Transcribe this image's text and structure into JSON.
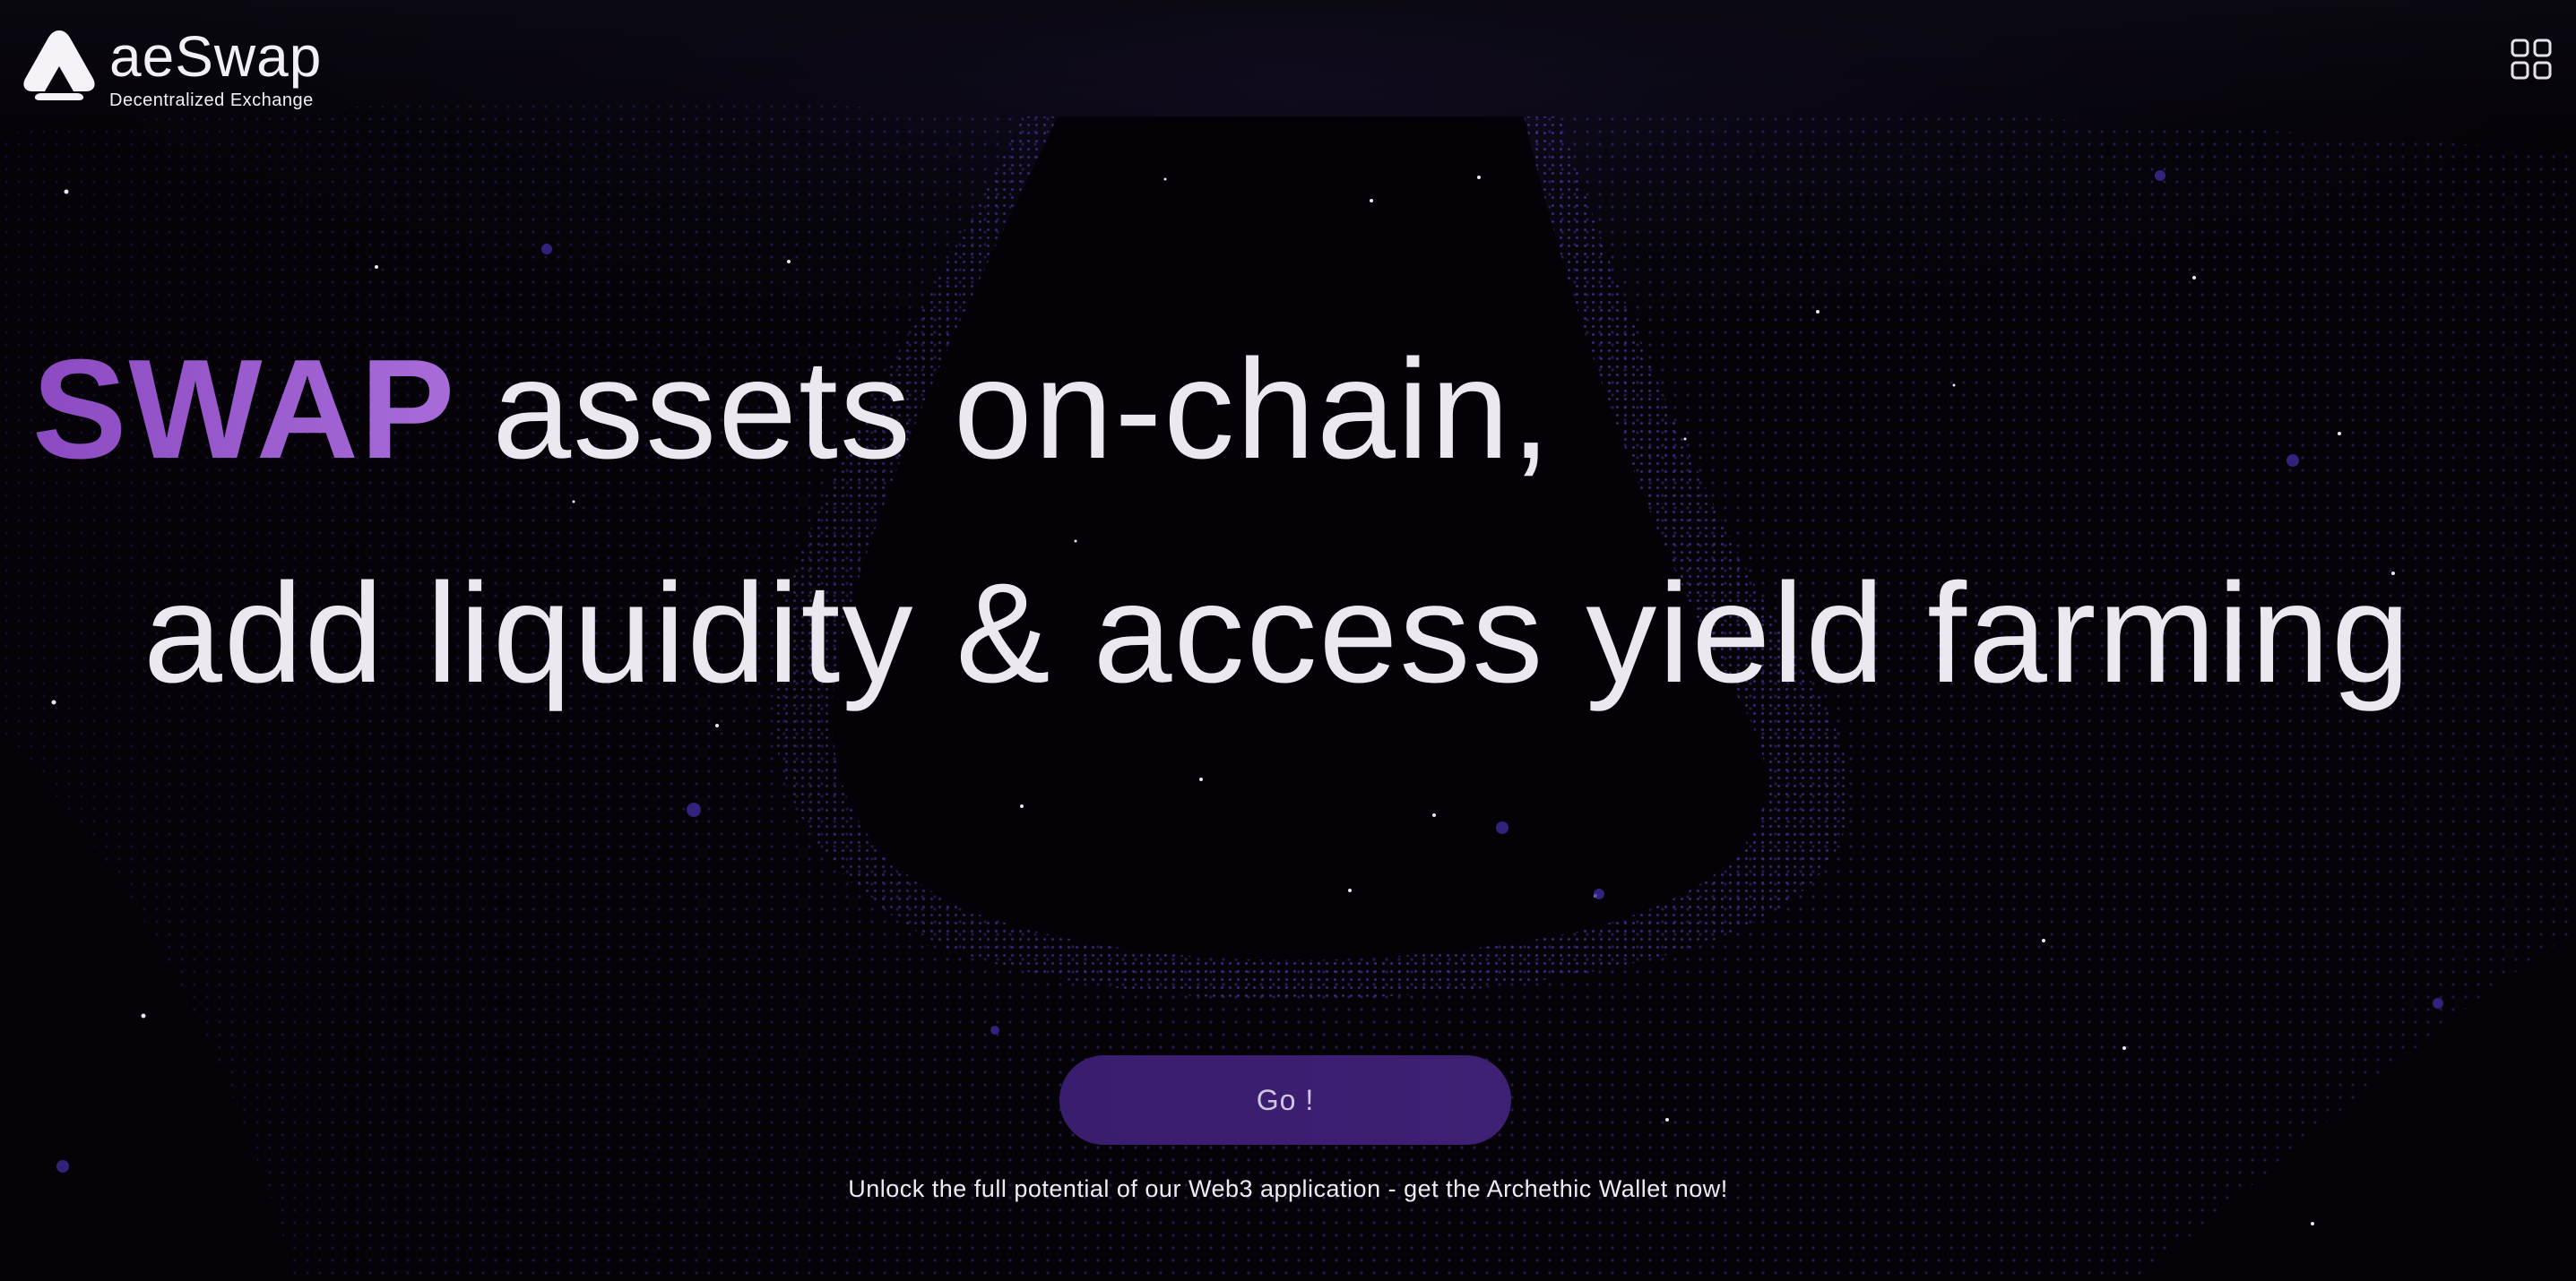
{
  "brand": {
    "name": "aeSwap",
    "tagline": "Decentralized Exchange"
  },
  "header": {
    "menu_icon": "grid-icon"
  },
  "hero": {
    "accent_word": "SWAP",
    "line1_rest": "assets on-chain,",
    "line2": "add liquidity & access yield farming"
  },
  "cta": {
    "go_label": "Go !",
    "wallet_text": "Unlock the full potential of our Web3 application - get the Archethic Wallet now!"
  },
  "colors": {
    "background": "#050308",
    "accent": "#9b59d0",
    "button": "#3b1e70",
    "text": "#ece8f0",
    "particles": "#3b2a8a"
  }
}
